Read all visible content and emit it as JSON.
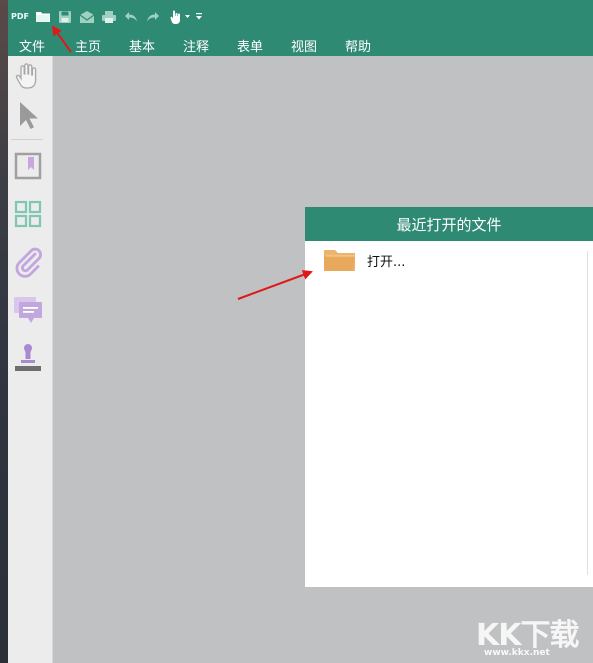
{
  "toolbar": {
    "logo_text": "PDF",
    "quick_access": [
      {
        "name": "open-folder-icon"
      },
      {
        "name": "save-icon"
      },
      {
        "name": "email-icon"
      },
      {
        "name": "print-icon"
      },
      {
        "name": "undo-icon"
      },
      {
        "name": "redo-icon"
      },
      {
        "name": "hand-mode-icon"
      },
      {
        "name": "customize-icon"
      }
    ]
  },
  "menu": {
    "items": [
      "文件",
      "主页",
      "基本",
      "注释",
      "表单",
      "视图",
      "帮助"
    ]
  },
  "sidebar": {
    "icons": [
      "hand-tool-icon",
      "select-tool-icon",
      "bookmark-icon",
      "thumbnails-icon",
      "attachment-icon",
      "comments-icon",
      "stamp-icon"
    ]
  },
  "recent_panel": {
    "title": "最近打开的文件",
    "open_label": "打开..."
  },
  "watermark": {
    "big": "KK下载",
    "small": "www.kkx.net"
  },
  "colors": {
    "brand_green": "#2f8a74",
    "folder": "#e8a95c",
    "annotation_red": "#e01818"
  }
}
